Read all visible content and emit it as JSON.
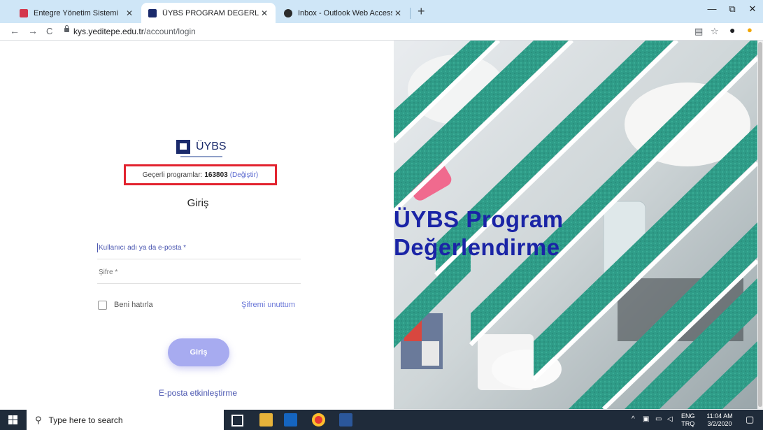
{
  "browser": {
    "tabs": [
      {
        "title": "Entegre Yönetim Sistemi",
        "active": false,
        "favicon_color": "#d4364b"
      },
      {
        "title": "ÜYBS PROGRAM DEGERLENDİRM",
        "active": true,
        "favicon_color": "#1a2a6b"
      },
      {
        "title": "Inbox - Outlook Web Access Ligh",
        "active": false,
        "favicon_color": "#2b2b2b"
      }
    ],
    "tab_close_glyph": "✕",
    "new_tab_glyph": "+",
    "url_host": "kys.yeditepe.edu.tr",
    "url_path": "/account/login",
    "window": {
      "minimize": "—",
      "restore": "⧉",
      "close": "✕"
    }
  },
  "login": {
    "logo_text": "ÜYBS",
    "programs_label": "Geçerli programlar:",
    "programs_value": "163803",
    "programs_change": "(Değiştir)",
    "title": "Giriş",
    "username_placeholder": "Kullanıcı adı ya da e-posta *",
    "password_placeholder": "Şifre *",
    "remember_label": "Beni hatırla",
    "forgot_label": "Şifremi unuttum",
    "submit_label": "Giriş",
    "email_activation_label": "E-posta etkinleştirme"
  },
  "hero": {
    "line1": "ÜYBS Program",
    "line2": "Değerlendirme"
  },
  "taskbar": {
    "search_placeholder": "Type here to search",
    "lang_top": "ENG",
    "lang_bottom": "TRQ",
    "time": "11:04 AM",
    "date": "3/2/2020"
  },
  "colors": {
    "accent": "#4a56b0",
    "highlight_box": "#e2232f",
    "button": "#a7abf0",
    "hero_text": "#1a24a6",
    "teal": "#2f9c88"
  }
}
